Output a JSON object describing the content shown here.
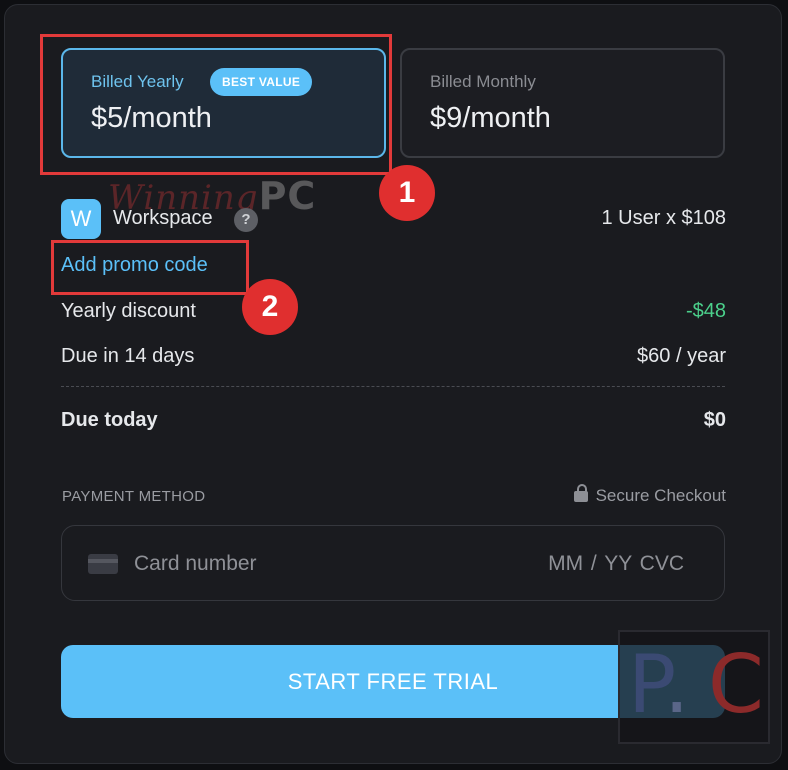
{
  "plans": {
    "yearly": {
      "label": "Billed Yearly",
      "badge": "BEST VALUE",
      "price": "$5/month"
    },
    "monthly": {
      "label": "Billed Monthly",
      "price": "$9/month"
    }
  },
  "annotations": {
    "marker_1": "1",
    "marker_2": "2"
  },
  "watermark": {
    "script_text": "Winning",
    "bold_text": "PC"
  },
  "summary": {
    "workspace": {
      "icon_letter": "W",
      "label": "Workspace",
      "help": "?",
      "amount": "1 User x $108"
    },
    "promo_link": "Add promo code",
    "discount": {
      "label": "Yearly discount",
      "amount": "-$48"
    },
    "due_later": {
      "label": "Due in 14 days",
      "amount": "$60 / year"
    },
    "due_today": {
      "label": "Due today",
      "amount": "$0"
    }
  },
  "payment": {
    "section_label": "PAYMENT METHOD",
    "secure_label": "Secure Checkout",
    "card_placeholder": "Card number",
    "expiry_cvc_placeholder": "MM / YY  CVC"
  },
  "cta_label": "START FREE TRIAL",
  "colors": {
    "accent": "#5bc0f8",
    "discount_green": "#4bd08b",
    "annotation_red": "#e23a3a",
    "background": "#1a1b1f"
  }
}
